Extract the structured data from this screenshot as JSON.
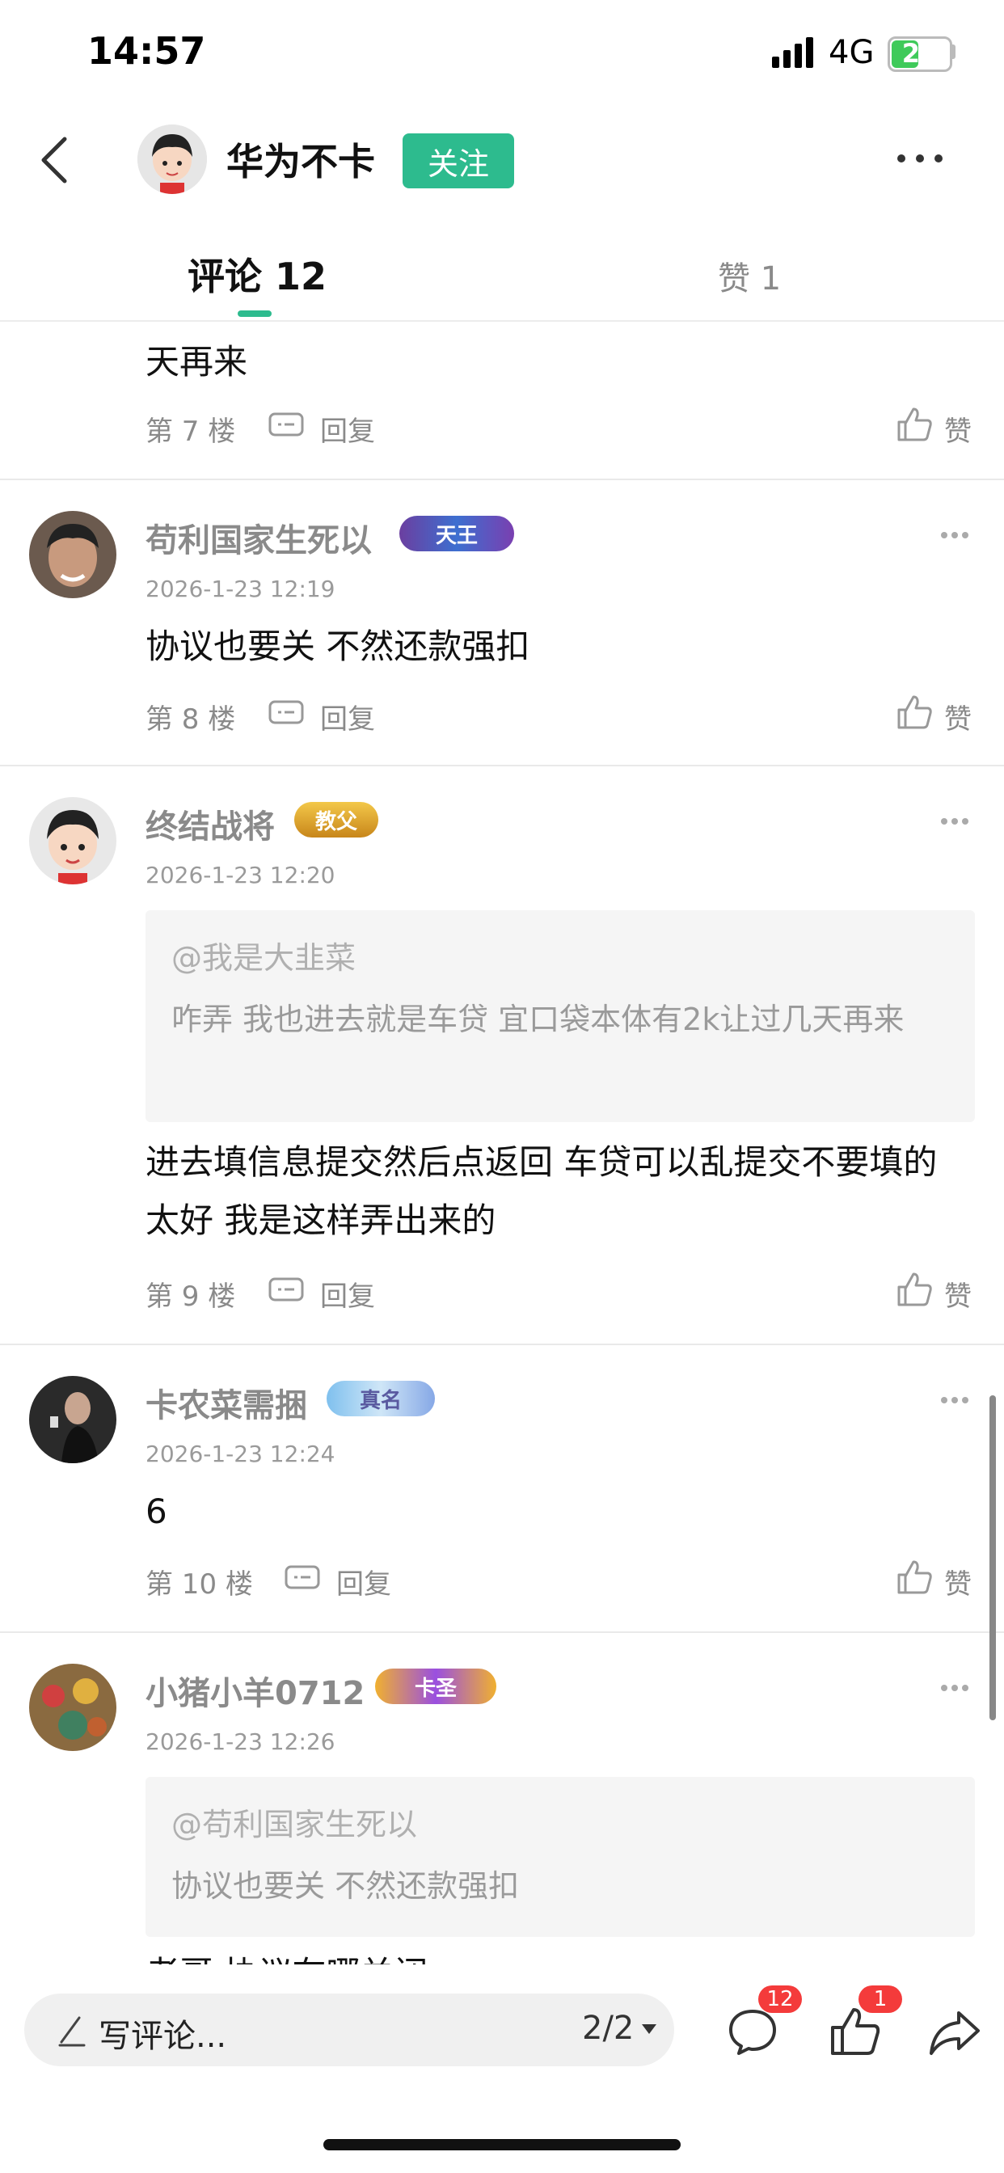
{
  "status": {
    "time": "14:57",
    "network": "4G",
    "battery": "25"
  },
  "header": {
    "username": "华为不卡",
    "follow_label": "关注"
  },
  "tabs": {
    "comments_label": "评论 12",
    "likes_label": "赞 1"
  },
  "comments": [
    {
      "text": "天再来",
      "floor": "第 7 楼",
      "reply": "回复",
      "like": "赞"
    },
    {
      "username": "苟利国家生死以",
      "badge": "天王",
      "date": "2026-1-23 12:19",
      "text": "协议也要关 不然还款强扣",
      "floor": "第 8 楼",
      "reply": "回复",
      "like": "赞"
    },
    {
      "username": "终结战将",
      "badge": "教父",
      "date": "2026-1-23 12:20",
      "quote_user": "@我是大韭菜",
      "quote_text": "咋弄 我也进去就是车贷 宜口袋本体有2k让过几天再来",
      "text": "进去填信息提交然后点返回 车贷可以乱提交不要填的太好 我是这样弄出来的",
      "floor": "第 9 楼",
      "reply": "回复",
      "like": "赞"
    },
    {
      "username": "卡农菜需捆",
      "badge": "真名",
      "date": "2026-1-23 12:24",
      "text": "6",
      "floor": "第 10 楼",
      "reply": "回复",
      "like": "赞"
    },
    {
      "username": "小猪小羊0712",
      "badge": "卡圣",
      "date": "2026-1-23 12:26",
      "quote_user": "@苟利国家生死以",
      "quote_text": "协议也要关 不然还款强扣",
      "text": "老哥 协议在哪关闭"
    }
  ],
  "bottom": {
    "input_placeholder": "写评论...",
    "page_indicator": "2/2",
    "comment_count": "12",
    "like_count": "1"
  },
  "colors": {
    "accent": "#2dbb8e",
    "badge_red": "#f43b3b"
  }
}
